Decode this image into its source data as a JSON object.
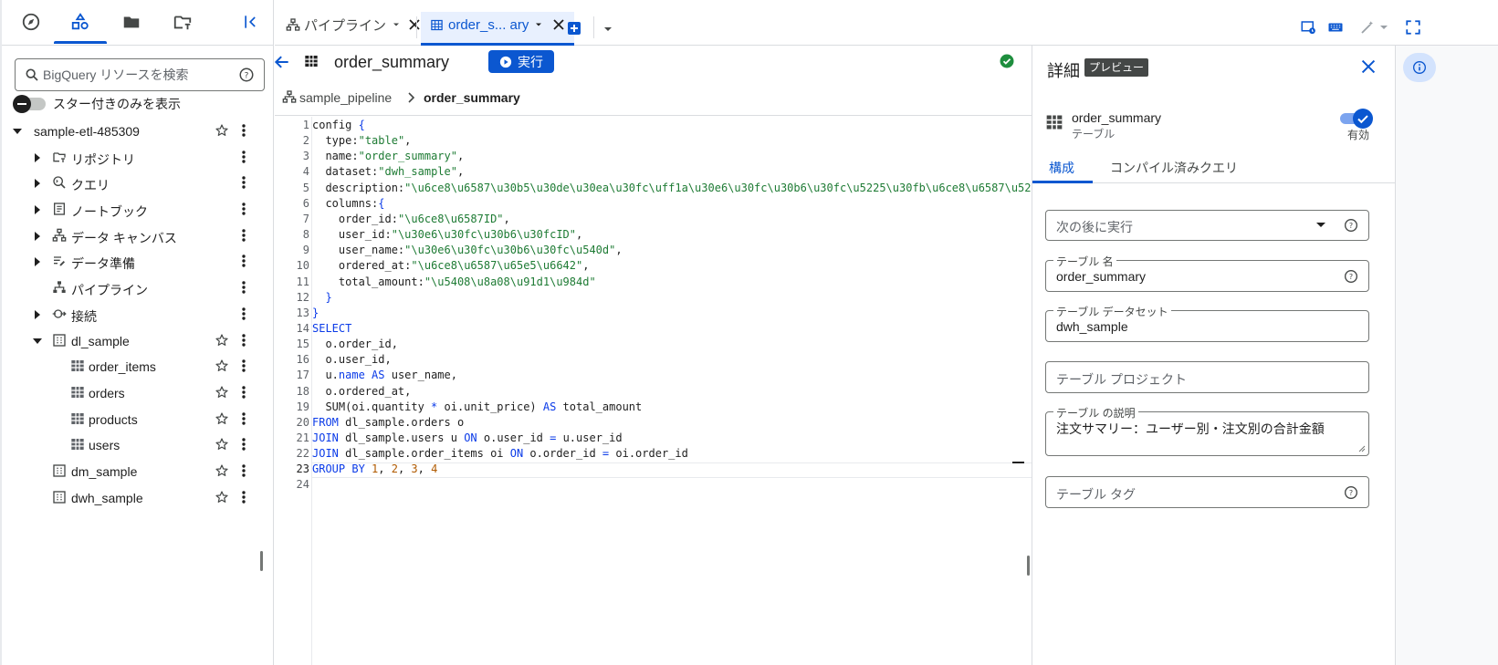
{
  "left_panel": {
    "search": {
      "placeholder": "BigQuery リソースを検索"
    },
    "starred_only_label": "スター付きのみを表示",
    "tree": [
      {
        "label": "sample-etl-485309",
        "icon": "none",
        "level": 0,
        "expand": "open",
        "star": true
      },
      {
        "label": "リポジトリ",
        "icon": "repository-icon",
        "level": 1,
        "expand": "closed",
        "star": false
      },
      {
        "label": "クエリ",
        "icon": "query-icon",
        "level": 1,
        "expand": "closed",
        "star": false
      },
      {
        "label": "ノートブック",
        "icon": "notebook-icon",
        "level": 1,
        "expand": "closed",
        "star": false
      },
      {
        "label": "データ キャンバス",
        "icon": "data-canvas-icon",
        "level": 1,
        "expand": "closed",
        "star": false
      },
      {
        "label": "データ準備",
        "icon": "data-prep-icon",
        "level": 1,
        "expand": "closed",
        "star": false
      },
      {
        "label": "パイプライン",
        "icon": "pipeline-icon",
        "level": 1,
        "expand": "none",
        "star": false
      },
      {
        "label": "接続",
        "icon": "connection-icon",
        "level": 1,
        "expand": "closed",
        "star": false
      },
      {
        "label": "dl_sample",
        "icon": "dataset-icon",
        "level": 1,
        "expand": "open",
        "star": true
      },
      {
        "label": "order_items",
        "icon": "table-icon",
        "level": 2,
        "expand": "none",
        "star": true
      },
      {
        "label": "orders",
        "icon": "table-icon",
        "level": 2,
        "expand": "none",
        "star": true
      },
      {
        "label": "products",
        "icon": "table-icon",
        "level": 2,
        "expand": "none",
        "star": true
      },
      {
        "label": "users",
        "icon": "table-icon",
        "level": 2,
        "expand": "none",
        "star": true
      },
      {
        "label": "dm_sample",
        "icon": "dataset-icon",
        "level": 1,
        "expand": "none",
        "star": true
      },
      {
        "label": "dwh_sample",
        "icon": "dataset-icon",
        "level": 1,
        "expand": "none",
        "star": true
      }
    ]
  },
  "tabs": {
    "pipeline_label": "パイプライン",
    "order_label": "order_s... ary"
  },
  "editor": {
    "title": "order_summary",
    "run_label": "実行",
    "breadcrumb": {
      "parent": "sample_pipeline",
      "current": "order_summary"
    },
    "code_lines": [
      [
        [
          "kw",
          "config "
        ],
        [
          "k",
          "{"
        ]
      ],
      [
        [
          "kw",
          "  type"
        ],
        [
          "kw",
          ":"
        ],
        [
          "s",
          "\"table\""
        ],
        [
          "kw",
          ","
        ]
      ],
      [
        [
          "kw",
          "  name"
        ],
        [
          "kw",
          ":"
        ],
        [
          "s",
          "\"order_summary\""
        ],
        [
          "kw",
          ","
        ]
      ],
      [
        [
          "kw",
          "  dataset"
        ],
        [
          "kw",
          ":"
        ],
        [
          "s",
          "\"dwh_sample\""
        ],
        [
          "kw",
          ","
        ]
      ],
      [
        [
          "kw",
          "  description"
        ],
        [
          "kw",
          ":"
        ],
        [
          "s",
          "\"\\u6ce8\\u6587\\u30b5\\u30de\\u30ea\\u30fc\\uff1a\\u30e6\\u30fc\\u30b6\\u30fc\\u5225\\u30fb\\u6ce8\\u6587\\u5225\\u"
        ]
      ],
      [
        [
          "kw",
          "  columns"
        ],
        [
          "kw",
          ":"
        ],
        [
          "k",
          "{"
        ]
      ],
      [
        [
          "kw",
          "    order_id"
        ],
        [
          "kw",
          ":"
        ],
        [
          "s",
          "\"\\u6ce8\\u6587ID\""
        ],
        [
          "kw",
          ","
        ]
      ],
      [
        [
          "kw",
          "    user_id"
        ],
        [
          "kw",
          ":"
        ],
        [
          "s",
          "\"\\u30e6\\u30fc\\u30b6\\u30fcID\""
        ],
        [
          "kw",
          ","
        ]
      ],
      [
        [
          "kw",
          "    user_name"
        ],
        [
          "kw",
          ":"
        ],
        [
          "s",
          "\"\\u30e6\\u30fc\\u30b6\\u30fc\\u540d\""
        ],
        [
          "kw",
          ","
        ]
      ],
      [
        [
          "kw",
          "    ordered_at"
        ],
        [
          "kw",
          ":"
        ],
        [
          "s",
          "\"\\u6ce8\\u6587\\u65e5\\u6642\""
        ],
        [
          "kw",
          ","
        ]
      ],
      [
        [
          "kw",
          "    total_amount"
        ],
        [
          "kw",
          ":"
        ],
        [
          "s",
          "\"\\u5408\\u8a08\\u91d1\\u984d\""
        ]
      ],
      [
        [
          "k",
          "  }"
        ]
      ],
      [
        [
          "k",
          "}"
        ]
      ],
      [
        [
          "k",
          "SELECT"
        ]
      ],
      [
        [
          "kw",
          "  o.order_id,"
        ]
      ],
      [
        [
          "kw",
          "  o.user_id,"
        ]
      ],
      [
        [
          "kw",
          "  u."
        ],
        [
          "k",
          "name"
        ],
        [
          "kw",
          " "
        ],
        [
          "k",
          "AS"
        ],
        [
          "kw",
          " user_name,"
        ]
      ],
      [
        [
          "kw",
          "  o.ordered_at,"
        ]
      ],
      [
        [
          "kw",
          "  SUM(oi.quantity "
        ],
        [
          "k",
          "*"
        ],
        [
          "kw",
          " oi.unit_price) "
        ],
        [
          "k",
          "AS"
        ],
        [
          "kw",
          " total_amount"
        ]
      ],
      [
        [
          "k",
          "FROM"
        ],
        [
          "kw",
          " dl_sample.orders o"
        ]
      ],
      [
        [
          "k",
          "JOIN"
        ],
        [
          "kw",
          " dl_sample.users u "
        ],
        [
          "k",
          "ON"
        ],
        [
          "kw",
          " o.user_id "
        ],
        [
          "k",
          "="
        ],
        [
          "kw",
          " u.user_id"
        ]
      ],
      [
        [
          "k",
          "JOIN"
        ],
        [
          "kw",
          " dl_sample.order_items oi "
        ],
        [
          "k",
          "ON"
        ],
        [
          "kw",
          " o.order_id "
        ],
        [
          "k",
          "="
        ],
        [
          "kw",
          " oi.order_id"
        ]
      ],
      [
        [
          "k",
          "GROUP BY"
        ],
        [
          "kw",
          " "
        ],
        [
          "n",
          "1"
        ],
        [
          "kw",
          ", "
        ],
        [
          "n",
          "2"
        ],
        [
          "kw",
          ", "
        ],
        [
          "n",
          "3"
        ],
        [
          "kw",
          ", "
        ],
        [
          "n",
          "4"
        ]
      ],
      [
        [
          "kw",
          ""
        ]
      ]
    ],
    "current_line": 23
  },
  "details": {
    "title": "詳細",
    "preview_badge": "プレビュー",
    "object_name": "order_summary",
    "object_type": "テーブル",
    "enabled_label": "有効",
    "tabs": [
      "構成",
      "コンパイル済みクエリ"
    ],
    "fields": {
      "run_after_placeholder": "次の後に実行",
      "table_name_label": "テーブル 名",
      "table_name_value": "order_summary",
      "dataset_label": "テーブル データセット",
      "dataset_value": "dwh_sample",
      "project_placeholder": "テーブル プロジェクト",
      "description_label": "テーブル の説明",
      "description_value": "注文サマリー：ユーザー別・注文別の合計金額",
      "tags_placeholder": "テーブル タグ"
    }
  },
  "colors": {
    "accent": "#0b57d0",
    "keyword": "#0b3be8",
    "string": "#1e7b34",
    "number": "#b05a00",
    "success": "#1e8e3e"
  }
}
